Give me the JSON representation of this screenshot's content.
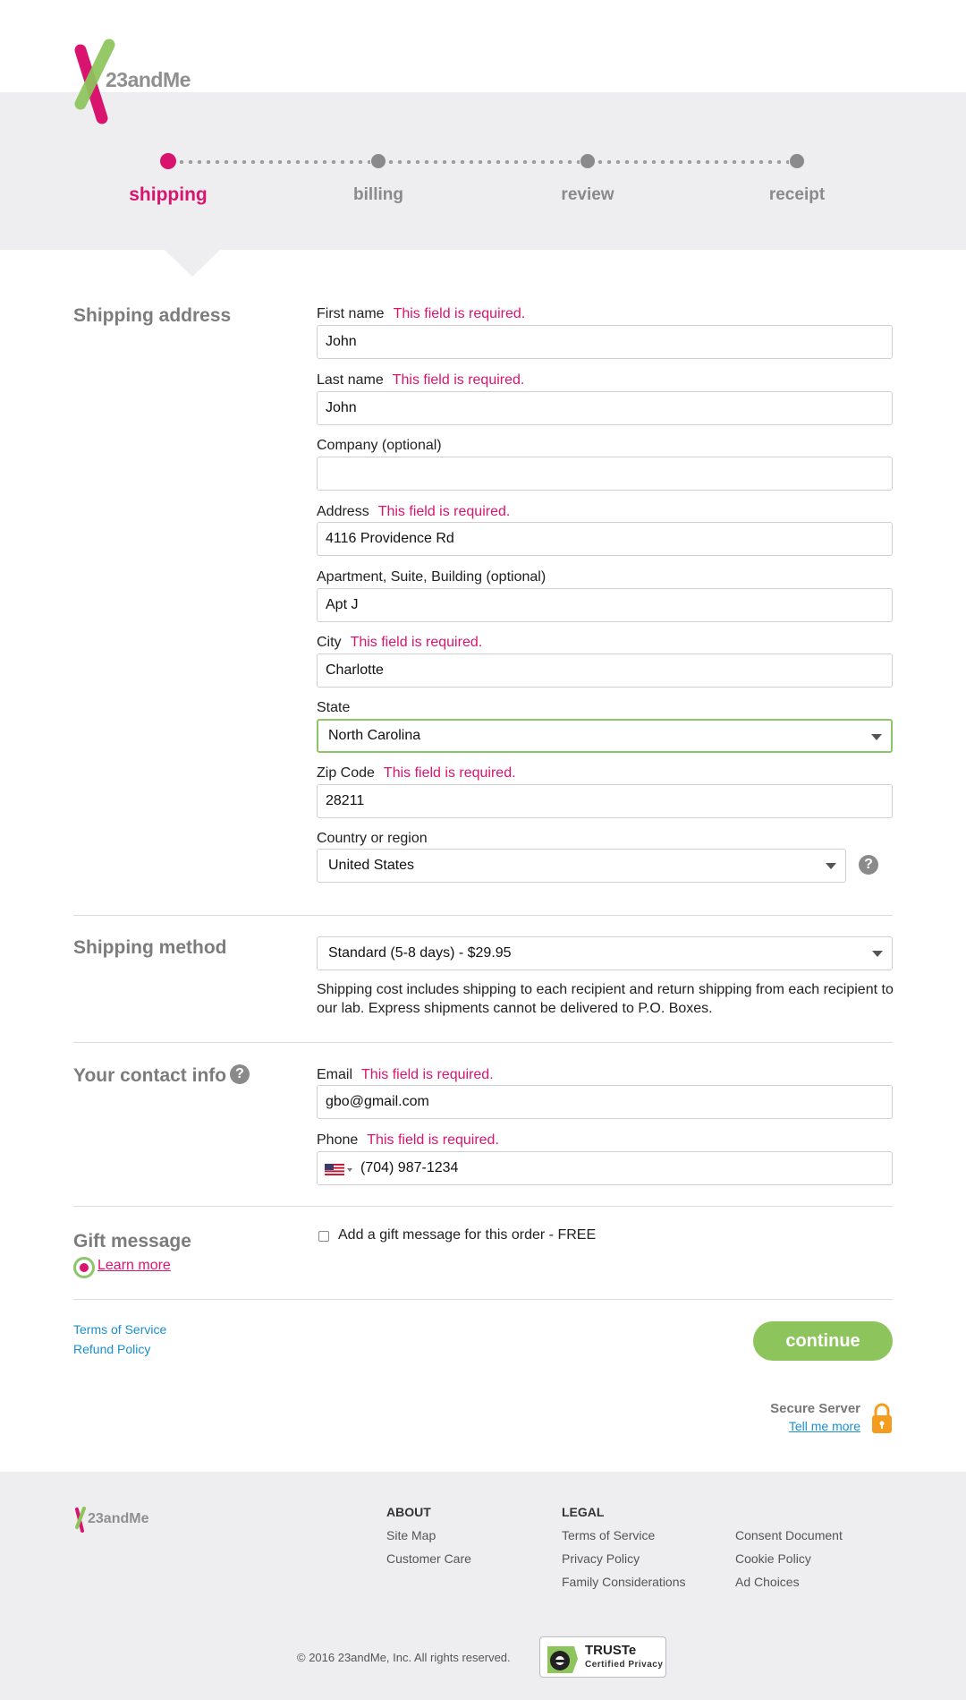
{
  "brand": {
    "name": "23andMe"
  },
  "progress": {
    "steps": [
      {
        "label": "shipping",
        "active": true
      },
      {
        "label": "billing",
        "active": false
      },
      {
        "label": "review",
        "active": false
      },
      {
        "label": "receipt",
        "active": false
      }
    ]
  },
  "shipping_address": {
    "title": "Shipping address",
    "required_msg": "This field is required.",
    "first_name": {
      "label": "First name",
      "value": "John"
    },
    "last_name": {
      "label": "Last name",
      "value": "John"
    },
    "company": {
      "label": "Company (optional)",
      "value": ""
    },
    "address": {
      "label": "Address",
      "value": "4116 Providence Rd"
    },
    "apartment": {
      "label": "Apartment, Suite, Building (optional)",
      "value": "Apt J"
    },
    "city": {
      "label": "City",
      "value": "Charlotte"
    },
    "state": {
      "label": "State",
      "value": "North Carolina"
    },
    "zip": {
      "label": "Zip Code",
      "value": "28211"
    },
    "country": {
      "label": "Country or region",
      "value": "United States"
    }
  },
  "shipping_method": {
    "title": "Shipping method",
    "selected": "Standard (5-8 days) - $29.95",
    "note": "Shipping cost includes shipping to each recipient and return shipping from each recipient to our lab. Express shipments cannot be delivered to P.O. Boxes."
  },
  "contact": {
    "title": "Your contact info",
    "email": {
      "label": "Email",
      "value": "gbo@gmail.com"
    },
    "phone": {
      "label": "Phone",
      "value": "(704) 987-1234"
    }
  },
  "gift": {
    "title": "Gift message",
    "learn_more": "Learn more",
    "checkbox_label": "Add a gift message for this order - FREE",
    "checked": false
  },
  "links": {
    "terms": "Terms of Service",
    "refund": "Refund Policy"
  },
  "continue_label": "continue",
  "secure": {
    "title": "Secure Server",
    "link": "Tell me more"
  },
  "footer": {
    "about_head": "ABOUT",
    "about_links": [
      "Site Map",
      "Customer Care"
    ],
    "legal_head": "LEGAL",
    "legal_col1": [
      "Terms of Service",
      "Privacy Policy",
      "Family Considerations"
    ],
    "legal_col2": [
      "Consent Document",
      "Cookie Policy",
      "Ad Choices"
    ],
    "copyright": "© 2016 23andMe, Inc. All rights reserved.",
    "truste_title": "TRUSTe",
    "truste_sub": "Certified Privacy"
  },
  "colors": {
    "accent_pink": "#d9146e",
    "accent_green": "#8dc55c",
    "link_blue": "#1a8ed0",
    "band_gray": "#eeeef0"
  }
}
